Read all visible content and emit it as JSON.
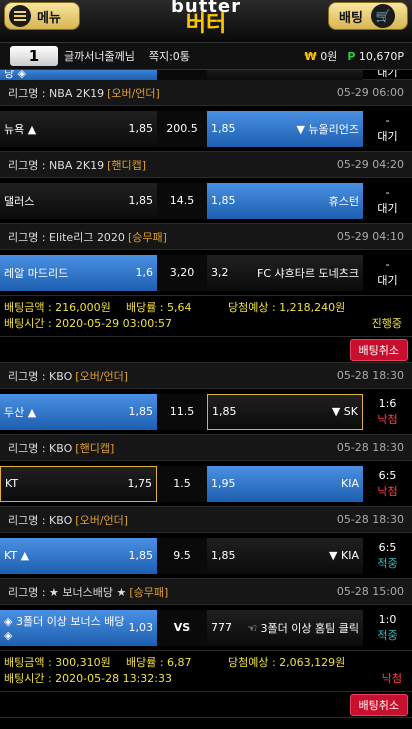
{
  "header": {
    "menu_label": "메뉴",
    "bet_label": "배팅",
    "logo_top": "butter",
    "logo_bottom": "버터"
  },
  "user": {
    "level": "1",
    "name": "글까서너줄께님",
    "messages": "쪽지:0통",
    "cash": "0원",
    "points": "10,670P"
  },
  "top_partial": {
    "home": "당 ◈",
    "res": "대기"
  },
  "slips": [
    {
      "league": "리그명 : NBA 2K19",
      "type": "[오버/언더]",
      "date": "05-29 06:00",
      "rows": [
        {
          "home": "뉴욕 ▲",
          "ho": "1,85",
          "mid": "200.5",
          "away_o": "1,85",
          "away": "▼ 뉴올리언즈",
          "r1": "-",
          "r2": "대기",
          "sel": "away"
        }
      ]
    },
    {
      "league": "리그명 : NBA 2K19",
      "type": "[핸디캡]",
      "date": "05-29 04:20",
      "rows": [
        {
          "home": "댈러스",
          "ho": "1,85",
          "mid": "14.5",
          "away_o": "1,85",
          "away": "휴스턴",
          "r1": "-",
          "r2": "대기",
          "sel": "away"
        }
      ]
    },
    {
      "league": "리그명 : Elite리그 2020",
      "type": "[승무패]",
      "date": "05-29 04:10",
      "rows": [
        {
          "home": "레알 마드리드",
          "ho": "1,6",
          "mid": "3,20",
          "away_o": "3,2",
          "away": "FC 샤흐타르 도네츠크",
          "r1": "-",
          "r2": "대기",
          "sel": "home"
        }
      ],
      "info": {
        "amt_label": "배팅금액 : 216,000원",
        "rate_label": "배당률 : 5,64",
        "exp_label": "당첨예상 : 1,218,240원",
        "time_label": "배팅시간 : 2020-05-29 03:00:57",
        "status": "진행중"
      },
      "cancel": "배팅취소"
    },
    {
      "league": "리그명 : KBO",
      "type": "[오버/언더]",
      "date": "05-28 18:30",
      "rows": [
        {
          "home": "두산 ▲",
          "ho": "1,85",
          "mid": "11.5",
          "away_o": "1,85",
          "away": "▼ SK",
          "r1": "1:6",
          "r2": "낙첨",
          "sel": "home",
          "gold": "away"
        }
      ]
    },
    {
      "league": "리그명 : KBO",
      "type": "[핸디캡]",
      "date": "05-28 18:30",
      "rows": [
        {
          "home": "KT",
          "ho": "1,75",
          "mid": "1.5",
          "away_o": "1,95",
          "away": "KIA",
          "r1": "6:5",
          "r2": "낙첨",
          "sel": "away",
          "gold": "home"
        }
      ]
    },
    {
      "league": "리그명 : KBO",
      "type": "[오버/언더]",
      "date": "05-28 18:30",
      "rows": [
        {
          "home": "KT ▲",
          "ho": "1,85",
          "mid": "9.5",
          "away_o": "1,85",
          "away": "▼ KIA",
          "r1": "6:5",
          "r2": "적중",
          "sel": "home"
        }
      ]
    },
    {
      "league": "리그명 : ★ 보너스배당 ★",
      "type": "[승무패]",
      "date": "05-28 15:00",
      "rows": [
        {
          "home": "◈ 3폴더 이상 보너스 배당 ◈",
          "ho": "1,03",
          "mid": "VS",
          "away_o": "777",
          "away": "☜ 3폴더 이상 홈팀 클릭",
          "r1": "1:0",
          "r2": "적중",
          "sel": "home"
        }
      ],
      "info": {
        "amt_label": "배팅금액 : 300,310원",
        "rate_label": "배당률 : 6,87",
        "exp_label": "당첨예상 : 2,063,129원",
        "time_label": "배팅시간 : 2020-05-28 13:32:33",
        "status": "낙첨"
      },
      "cancel": "배팅취소"
    }
  ]
}
